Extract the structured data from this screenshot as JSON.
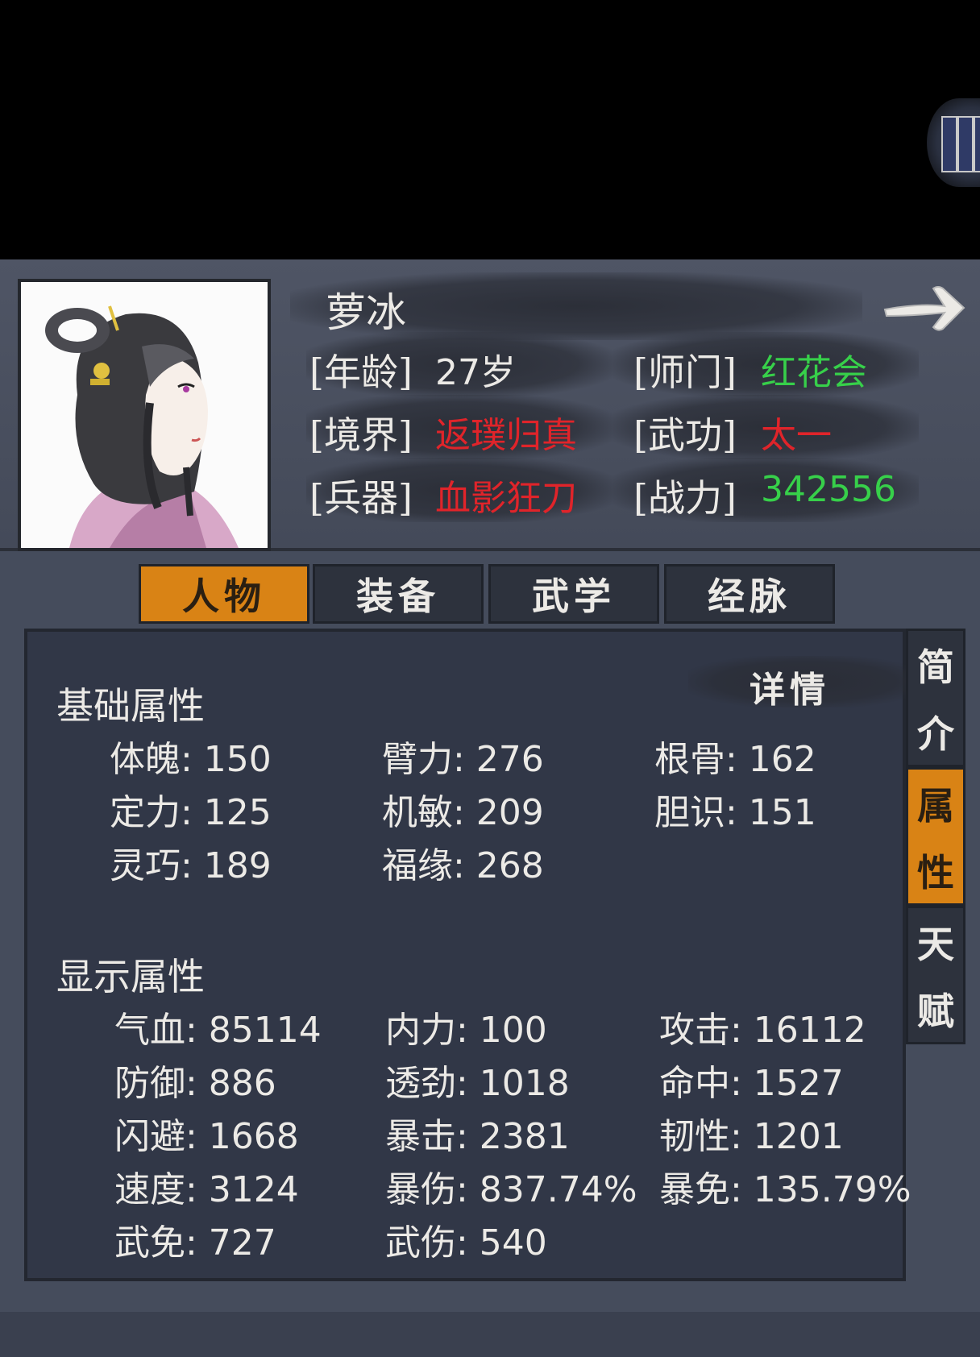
{
  "character": {
    "name": "萝冰",
    "info": [
      {
        "label": "[年龄]",
        "value": "27岁",
        "color": "#eceae6"
      },
      {
        "label": "[师门]",
        "value": "红花会",
        "color": "#37d04a"
      },
      {
        "label": "[境界]",
        "value": "返璞归真",
        "color": "#e0242a"
      },
      {
        "label": "[武功]",
        "value": "太一",
        "color": "#e0242a"
      },
      {
        "label": "[兵器]",
        "value": "血影狂刀",
        "color": "#e0242a"
      },
      {
        "label": "[战力]",
        "value": "342556",
        "color": "#37d04a"
      }
    ]
  },
  "icons": {
    "next": "right-arrow-icon",
    "portrait": "character-portrait"
  },
  "tabs": [
    "人物",
    "装备",
    "武学",
    "经脉"
  ],
  "side_tabs": [
    {
      "chars": [
        "简",
        "介"
      ]
    },
    {
      "chars": [
        "属",
        "性"
      ]
    },
    {
      "chars": [
        "天",
        "赋"
      ]
    }
  ],
  "details_label": "详情",
  "base_section": {
    "title": "基础属性",
    "stats": [
      "体魄: 150",
      "臂力: 276",
      "根骨: 162",
      "定力: 125",
      "机敏: 209",
      "胆识: 151",
      "灵巧: 189",
      "福缘: 268"
    ]
  },
  "display_section": {
    "title": "显示属性",
    "stats": [
      "气血: 85114",
      "内力: 100",
      "攻击: 16112",
      "防御: 886",
      "透劲: 1018",
      "命中: 1527",
      "闪避: 1668",
      "暴击: 2381",
      "韧性: 1201",
      "速度: 3124",
      "暴伤: 837.74%",
      "暴免: 135.79%",
      "武免: 727",
      "武伤: 540"
    ]
  },
  "colors": {
    "accent": "#d98315",
    "panel": "#454c5c",
    "content": "#313747"
  }
}
